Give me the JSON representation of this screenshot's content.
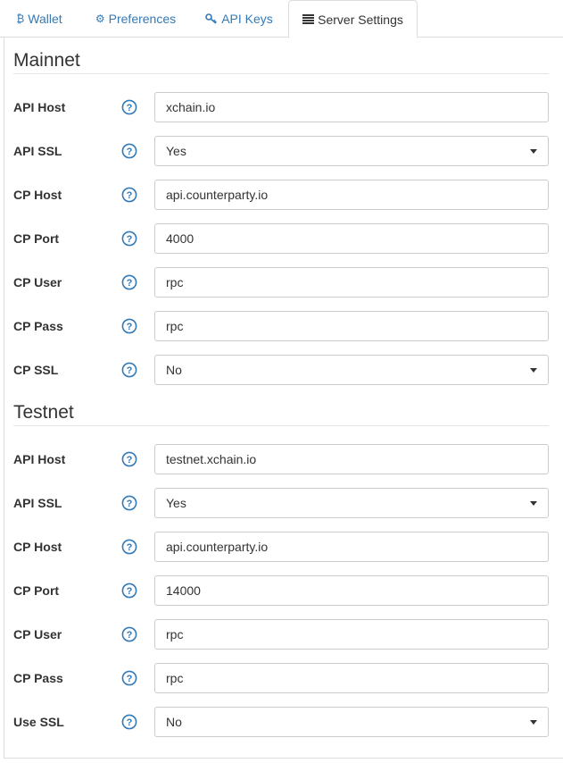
{
  "tabs": [
    {
      "label": "Wallet",
      "icon": "bitcoin-icon"
    },
    {
      "label": "Preferences",
      "icon": "gear-icon"
    },
    {
      "label": "API Keys",
      "icon": "key-icon"
    },
    {
      "label": "Server Settings",
      "icon": "server-list-icon",
      "active": true
    }
  ],
  "colors": {
    "link": "#337ab7",
    "help": "#337ab7",
    "border": "#cccccc"
  },
  "mainnet": {
    "title": "Mainnet",
    "fields": [
      {
        "label": "API Host",
        "value": "xchain.io",
        "type": "input"
      },
      {
        "label": "API SSL",
        "value": "Yes",
        "type": "select"
      },
      {
        "label": "CP Host",
        "value": "api.counterparty.io",
        "type": "input"
      },
      {
        "label": "CP Port",
        "value": "4000",
        "type": "input"
      },
      {
        "label": "CP User",
        "value": "rpc",
        "type": "input"
      },
      {
        "label": "CP Pass",
        "value": "rpc",
        "type": "input"
      },
      {
        "label": "CP SSL",
        "value": "No",
        "type": "select"
      }
    ]
  },
  "testnet": {
    "title": "Testnet",
    "fields": [
      {
        "label": "API Host",
        "value": "testnet.xchain.io",
        "type": "input"
      },
      {
        "label": "API SSL",
        "value": "Yes",
        "type": "select"
      },
      {
        "label": "CP Host",
        "value": "api.counterparty.io",
        "type": "input"
      },
      {
        "label": "CP Port",
        "value": "14000",
        "type": "input"
      },
      {
        "label": "CP User",
        "value": "rpc",
        "type": "input"
      },
      {
        "label": "CP Pass",
        "value": "rpc",
        "type": "input"
      },
      {
        "label": "Use SSL",
        "value": "No",
        "type": "select"
      }
    ]
  }
}
